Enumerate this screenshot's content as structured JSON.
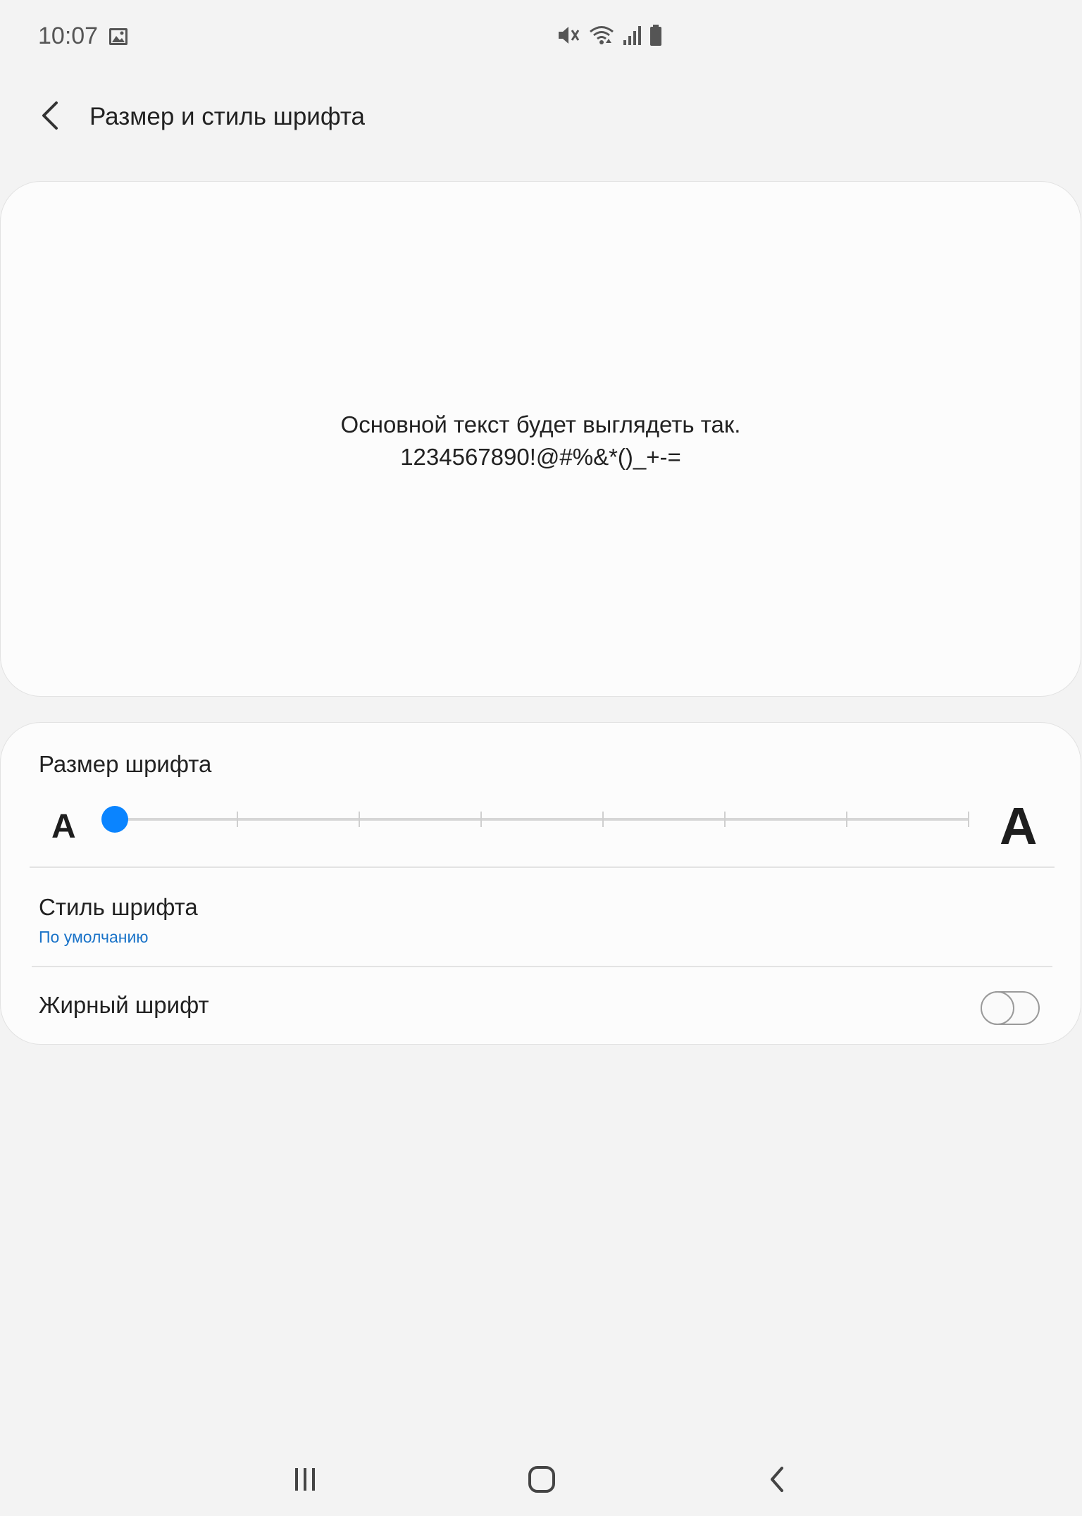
{
  "status_bar": {
    "time": "10:07",
    "left_icons": [
      "image-icon"
    ],
    "right_icons": [
      "mute-icon",
      "wifi-icon",
      "signal-icon",
      "battery-icon"
    ]
  },
  "header": {
    "title": "Размер и стиль шрифта",
    "back_icon": "chevron-left-icon"
  },
  "preview": {
    "line1": "Основной текст будет выглядеть так.",
    "line2": "1234567890!@#%&*()_+-="
  },
  "font_size": {
    "label": "Размер шрифта",
    "small_glyph": "A",
    "large_glyph": "A",
    "slider_steps": 8,
    "slider_value_index": 0
  },
  "font_style": {
    "label": "Стиль шрифта",
    "value": "По умолчанию"
  },
  "bold_font": {
    "label": "Жирный шрифт",
    "enabled": false
  },
  "navigation": {
    "icons": [
      "recents-icon",
      "home-icon",
      "back-icon"
    ]
  },
  "colors": {
    "accent": "#0a84ff",
    "link": "#1a73c8",
    "background": "#f3f3f3",
    "card": "#fcfcfc"
  }
}
